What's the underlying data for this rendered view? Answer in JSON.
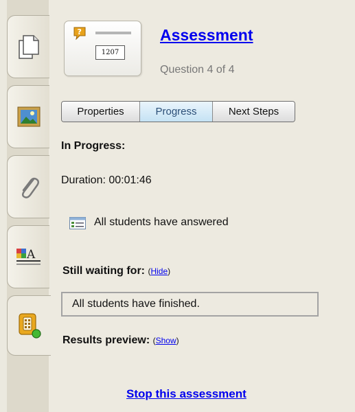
{
  "assessment": {
    "title": "Assessment",
    "subtitle": "Question 4 of 4",
    "thumbnail_value": "1207"
  },
  "tabs": [
    {
      "label": "pages",
      "icon": "page-icon"
    },
    {
      "label": "gallery",
      "icon": "picture-icon"
    },
    {
      "label": "attachments",
      "icon": "paperclip-icon"
    },
    {
      "label": "properties",
      "icon": "text-format-icon"
    },
    {
      "label": "response",
      "icon": "clicker-icon",
      "active": true
    }
  ],
  "segments": {
    "properties": "Properties",
    "progress": "Progress",
    "next_steps": "Next Steps",
    "active": "Progress"
  },
  "progress": {
    "heading": "In Progress:",
    "duration": "Duration: 00:01:46",
    "answered": "All students have answered",
    "waiting_label": "Still waiting for:",
    "hide_link": "Hide",
    "waiting_status": "All students have finished.",
    "results_label": "Results preview:",
    "show_link": "Show",
    "stop_link": "Stop this assessment"
  },
  "colors": {
    "panel_bg": "#edeae0",
    "link": "#0000ee",
    "active_segment": "#c5e2f4"
  }
}
